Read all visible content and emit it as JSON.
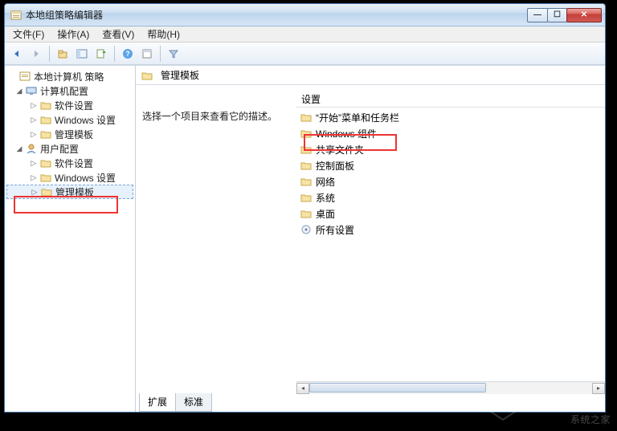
{
  "window": {
    "title": "本地组策略编辑器"
  },
  "menu": {
    "file": "文件(F)",
    "action": "操作(A)",
    "view": "查看(V)",
    "help": "帮助(H)"
  },
  "tree": {
    "root": "本地计算机 策略",
    "computer": "计算机配置",
    "user": "用户配置",
    "software": "软件设置",
    "windows": "Windows 设置",
    "admin": "管理模板"
  },
  "content": {
    "header_title": "管理模板",
    "desc": "选择一个项目来查看它的描述。",
    "col_setting": "设置",
    "items": [
      "“开始”菜单和任务栏",
      "Windows 组件",
      "共享文件夹",
      "控制面板",
      "网络",
      "系统",
      "桌面",
      "所有设置"
    ]
  },
  "tabs": {
    "extended": "扩展",
    "standard": "标准"
  },
  "watermark": "系统之家"
}
